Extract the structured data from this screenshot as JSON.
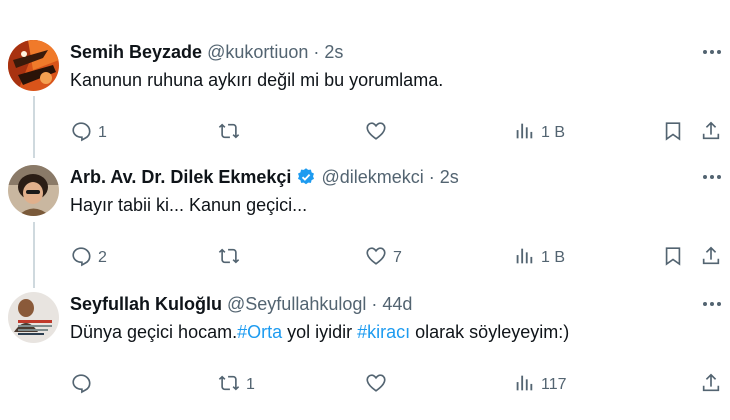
{
  "tweets": [
    {
      "name": "Semih Beyzade",
      "handle": "@kukortiuon",
      "time": "2s",
      "verified": false,
      "text": "Kanunun ruhuna aykırı değil mi bu yorumlama.",
      "counts": {
        "replies": "1",
        "reposts": "",
        "likes": "",
        "views": "1 B"
      }
    },
    {
      "name": "Arb. Av. Dr. Dilek Ekmekçi",
      "handle": "@dilekmekci",
      "time": "2s",
      "verified": true,
      "text": "Hayır tabii ki... Kanun geçici...",
      "counts": {
        "replies": "2",
        "reposts": "",
        "likes": "7",
        "views": "1 B"
      }
    },
    {
      "name": "Seyfullah Kuloğlu",
      "handle": "@Seyfullahkulogl",
      "time": "44d",
      "verified": false,
      "text_part1": "Dünya geçici hocam.",
      "hashtag1": "#Orta",
      "text_part2": " yol iyidir ",
      "hashtag2": "#kiracı",
      "text_part3": " olarak söyleyeyim:)",
      "counts": {
        "replies": "",
        "reposts": "1",
        "likes": "",
        "views": "117"
      }
    }
  ],
  "colors": {
    "accent": "#1d9bf0",
    "muted": "#536471",
    "text": "#0f1419"
  },
  "icons": [
    "reply-icon",
    "repost-icon",
    "like-icon",
    "views-icon",
    "bookmark-icon",
    "share-icon",
    "more-icon",
    "verified-icon"
  ]
}
